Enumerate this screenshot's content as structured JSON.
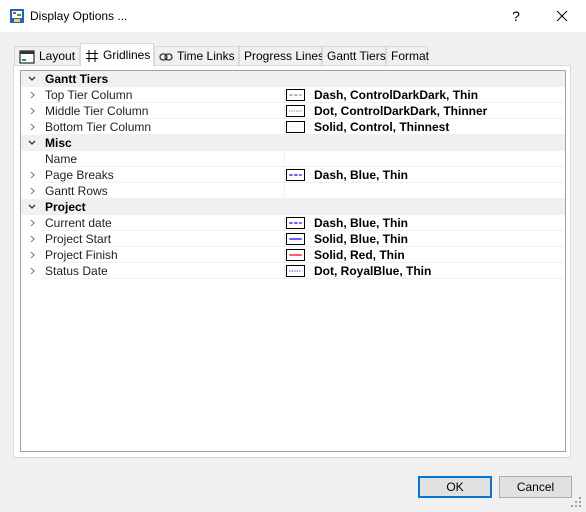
{
  "window": {
    "title": "Display Options ...",
    "help": "?"
  },
  "tabs": [
    {
      "label": "Layout"
    },
    {
      "label": "Gridlines"
    },
    {
      "label": "Time Links"
    },
    {
      "label": "Progress Lines"
    },
    {
      "label": "Gantt Tiers"
    },
    {
      "label": "Format"
    }
  ],
  "groups": [
    {
      "name": "Gantt Tiers"
    },
    {
      "name": "Misc"
    },
    {
      "name": "Project"
    }
  ],
  "properties": [
    {
      "label": "Top Tier Column",
      "value": "Dash, ControlDarkDark, Thin",
      "line_color": "#404040",
      "line_style": "dash"
    },
    {
      "label": "Middle Tier Column",
      "value": "Dot, ControlDarkDark, Thinner",
      "line_color": "#404040",
      "line_style": "dot"
    },
    {
      "label": "Bottom Tier Column",
      "value": "Solid, Control, Thinnest",
      "line_color": "#f0f0f0",
      "line_style": "solid"
    },
    {
      "label": "Name",
      "value": ""
    },
    {
      "label": "Page Breaks",
      "value": "Dash, Blue, Thin",
      "line_color": "#0000ff",
      "line_style": "dash"
    },
    {
      "label": "Gantt Rows",
      "value": ""
    },
    {
      "label": "Current date",
      "value": "Dash, Blue, Thin",
      "line_color": "#0000ff",
      "line_style": "dash"
    },
    {
      "label": "Project Start",
      "value": "Solid, Blue, Thin",
      "line_color": "#0000ff",
      "line_style": "solid"
    },
    {
      "label": "Project Finish",
      "value": "Solid, Red, Thin",
      "line_color": "#ff0000",
      "line_style": "solid"
    },
    {
      "label": "Status Date",
      "value": "Dot, RoyalBlue, Thin",
      "line_color": "#4169e1",
      "line_style": "dot"
    }
  ],
  "buttons": {
    "ok": "OK",
    "cancel": "Cancel"
  },
  "colors": {
    "accent": "#0078d7",
    "category_bg": "#f0f0f0"
  }
}
